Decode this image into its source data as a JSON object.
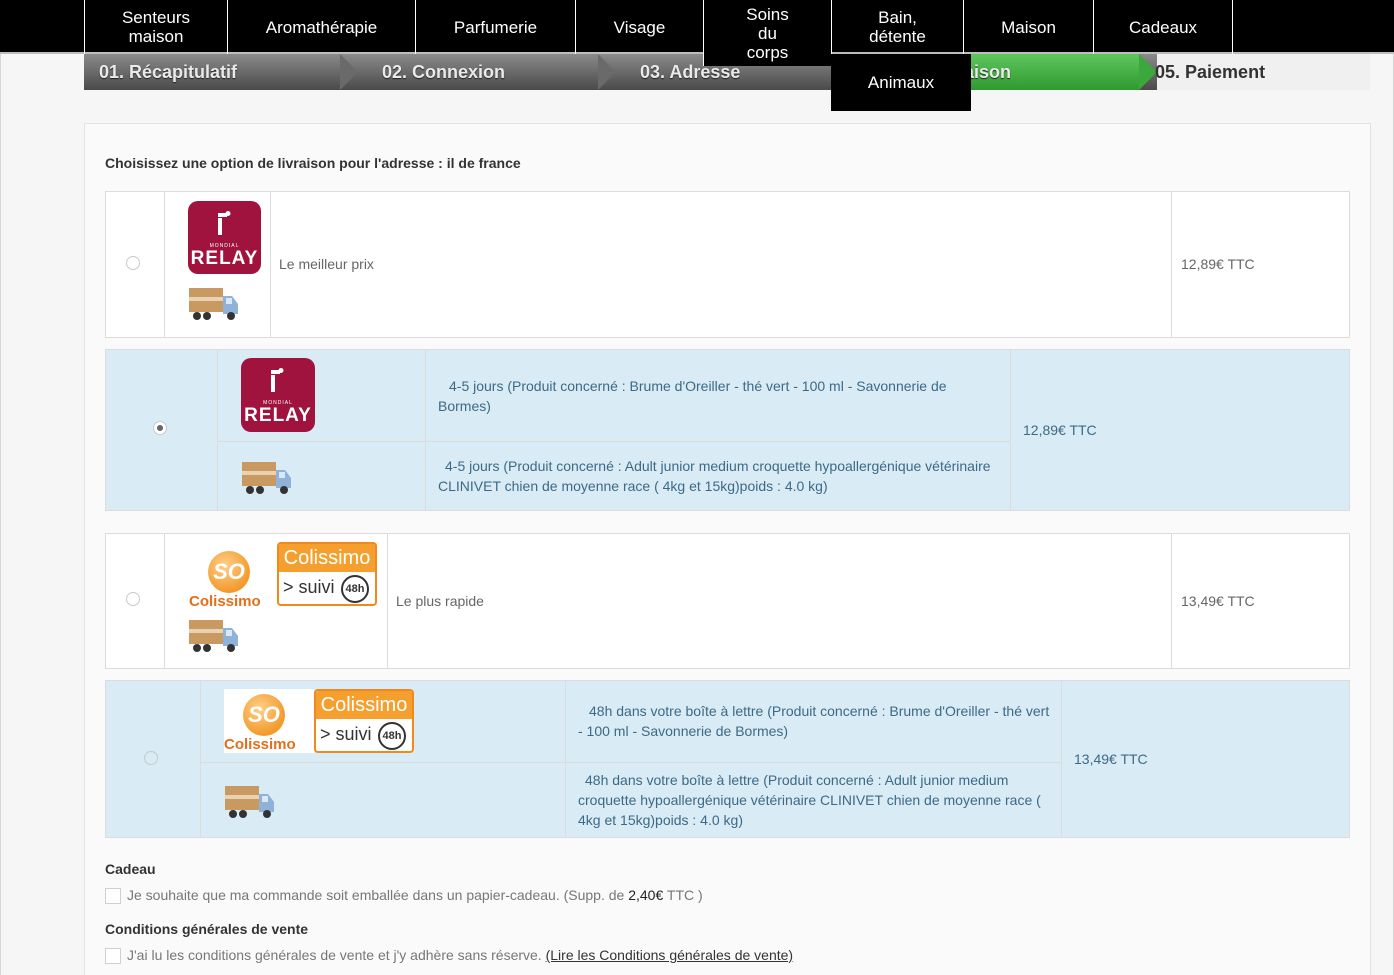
{
  "nav": {
    "items": [
      "Senteurs maison",
      "Aromathérapie",
      "Parfumerie",
      "Visage",
      "Soins du corps",
      "Bain, détente",
      "Maison",
      "Cadeaux"
    ],
    "dropdown_item": "Animaux"
  },
  "steps": {
    "step1": "01. Récapitulatif",
    "step2": "02. Connexion",
    "step3": "03. Adresse",
    "step4": "04. Livraison",
    "step5": "05. Paiement"
  },
  "delivery": {
    "heading": "Choisissez une option de livraison pour l'adresse : il de france",
    "options": [
      {
        "desc": "Le meilleur prix",
        "price": "12,89€ TTC",
        "selected": false,
        "carrier": "Mondial Relay"
      },
      {
        "desc1": "4-5 jours (Produit concerné : Brume d'Oreiller - thé vert - 100 ml - Savonnerie de Bormes)",
        "desc2": "4-5 jours (Produit concerné : Adult junior medium croquette hypoallergénique vétérinaire CLINIVET chien de moyenne race ( 4kg et 15kg)poids : 4.0 kg)",
        "price": "12,89€ TTC",
        "selected": true,
        "carrier": "Mondial Relay"
      },
      {
        "desc": "Le plus rapide",
        "price": "13,49€ TTC",
        "selected": false,
        "carrier": "So Colissimo"
      },
      {
        "desc1": "48h dans votre boîte à lettre (Produit concerné : Brume d'Oreiller - thé vert - 100 ml - Savonnerie de Bormes)",
        "desc2": "48h dans votre boîte à lettre (Produit concerné : Adult junior medium croquette hypoallergénique vétérinaire CLINIVET chien de moyenne race ( 4kg et 15kg)poids : 4.0 kg)",
        "price": "13,49€ TTC",
        "selected": false,
        "carrier": "So Colissimo"
      }
    ],
    "logo_relay_small": "MONDIAL",
    "logo_relay_big": "RELAY",
    "logo_so": "SO",
    "logo_so_word": "Colissimo",
    "logo_coli_top": "Colissimo",
    "logo_coli_bottom": "> suivi",
    "logo_coli_48": "48h"
  },
  "gift": {
    "title": "Cadeau",
    "label_before": "Je souhaite que ma commande soit emballée dans un papier-cadeau.  (Supp. de ",
    "amount": "2,40€",
    "label_after": " TTC )"
  },
  "cgv": {
    "title": "Conditions générales de vente",
    "label": "J'ai lu les conditions générales de vente et j'y adhère sans réserve. ",
    "link": "(Lire les Conditions générales de vente)"
  },
  "colors": {
    "selected_row": "#d9ebf5",
    "step_active": "#3aa83a",
    "relay_brand": "#a0133e",
    "colissimo_brand": "#f5a02e"
  }
}
